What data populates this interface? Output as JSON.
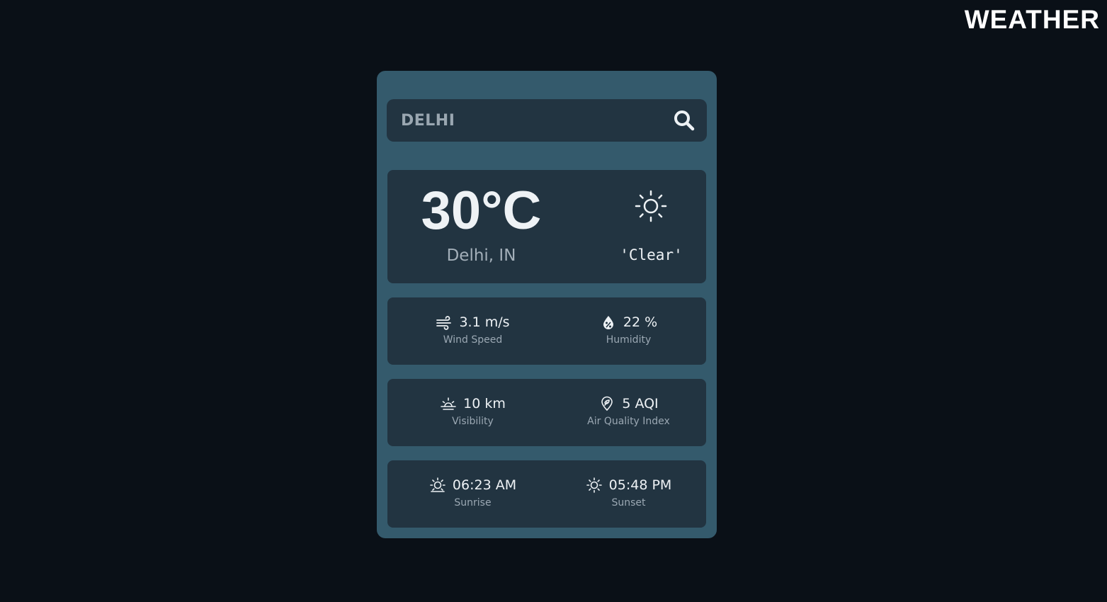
{
  "header": {
    "brand": "WEATHER"
  },
  "search": {
    "value": "DELHI",
    "icon": "search-icon"
  },
  "current": {
    "temperature": "30°C",
    "location": "Delhi, IN",
    "condition": "'Clear'",
    "condition_icon": "sun-icon"
  },
  "details": {
    "wind": {
      "value": "3.1 m/s",
      "label": "Wind Speed",
      "icon": "wind-icon"
    },
    "humidity": {
      "value": "22 %",
      "label": "Humidity",
      "icon": "humidity-icon"
    },
    "visibility": {
      "value": "10 km",
      "label": "Visibility",
      "icon": "visibility-icon"
    },
    "aqi": {
      "value": "5 AQI",
      "label": "Air Quality Index",
      "icon": "air-quality-icon"
    },
    "sunrise": {
      "value": "06:23 AM",
      "label": "Sunrise",
      "icon": "sunrise-icon"
    },
    "sunset": {
      "value": "05:48 PM",
      "label": "Sunset",
      "icon": "sunset-icon"
    }
  },
  "colors": {
    "page_background": "#0a1017",
    "card_background": "#345a6c",
    "panel_background": "#223441",
    "text_primary": "#eef2f5",
    "text_secondary": "#9ba8b3"
  }
}
